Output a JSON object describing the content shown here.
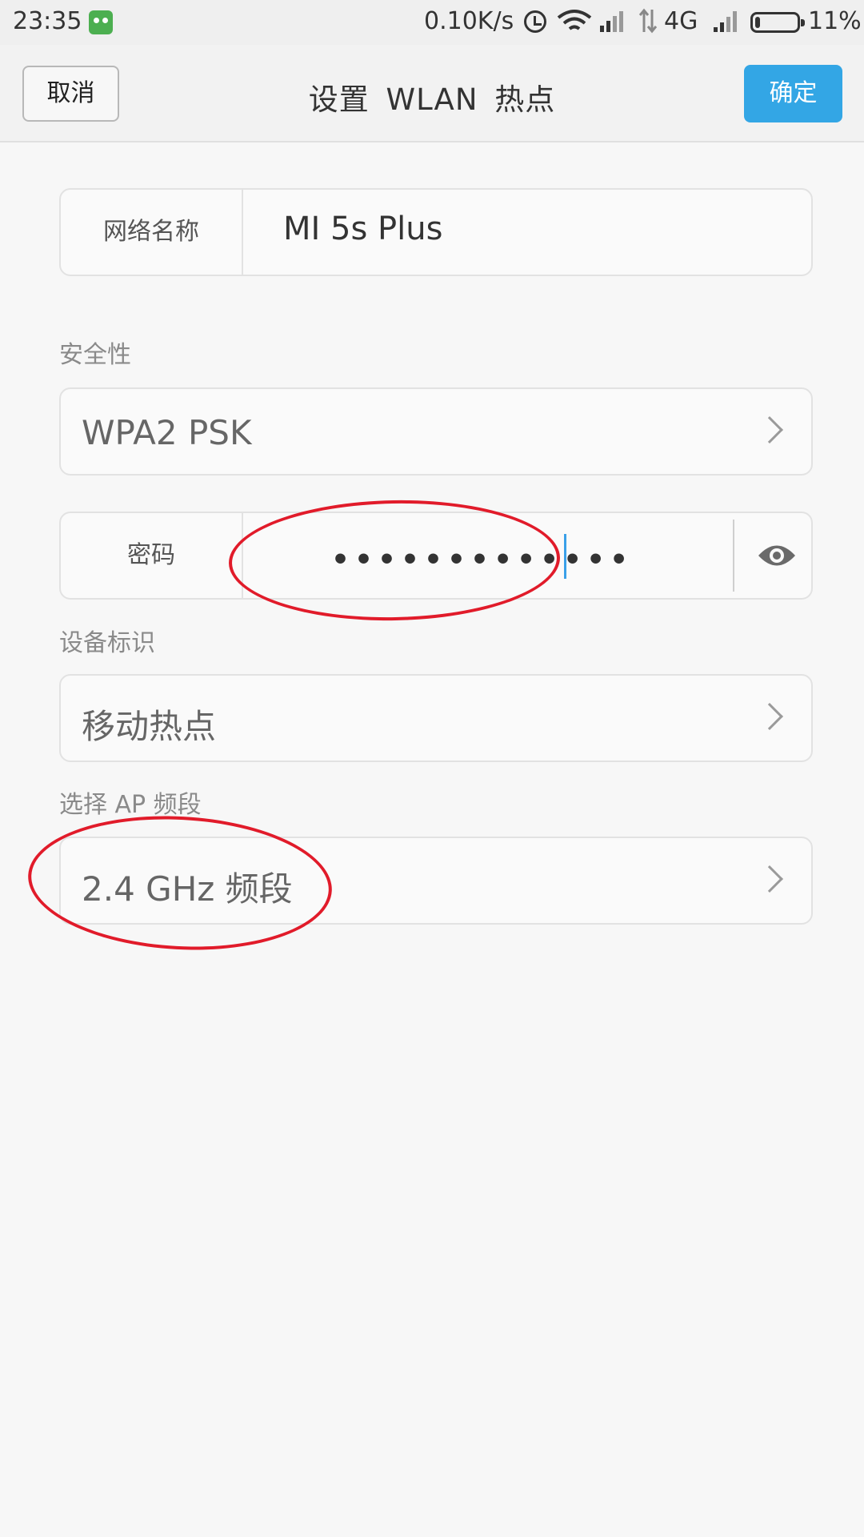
{
  "status_bar": {
    "time": "23:35",
    "net_speed": "0.10K/s",
    "network_type": "4G",
    "battery_percent": "11%",
    "battery_level": 0.11,
    "icons": [
      "app-icon",
      "alarm-icon",
      "wifi-icon",
      "hd-signal-icon",
      "data-arrows-icon",
      "signal-icon",
      "battery-icon"
    ]
  },
  "header": {
    "cancel_label": "取消",
    "title": "设置 WLAN 热点",
    "confirm_label": "确定"
  },
  "form": {
    "network_name_label": "网络名称",
    "network_name_value": "MI 5s Plus",
    "security_label": "安全性",
    "security_value": "WPA2 PSK",
    "password_label": "密码",
    "password_mask": "•••••••••••••",
    "device_id_label": "设备标识",
    "device_id_value": "移动热点",
    "ap_band_label": "选择 AP 频段",
    "ap_band_value": "2.4 GHz 频段"
  },
  "colors": {
    "accent": "#33a6e5",
    "annotation": "#e11b2a",
    "background": "#f7f7f7"
  }
}
